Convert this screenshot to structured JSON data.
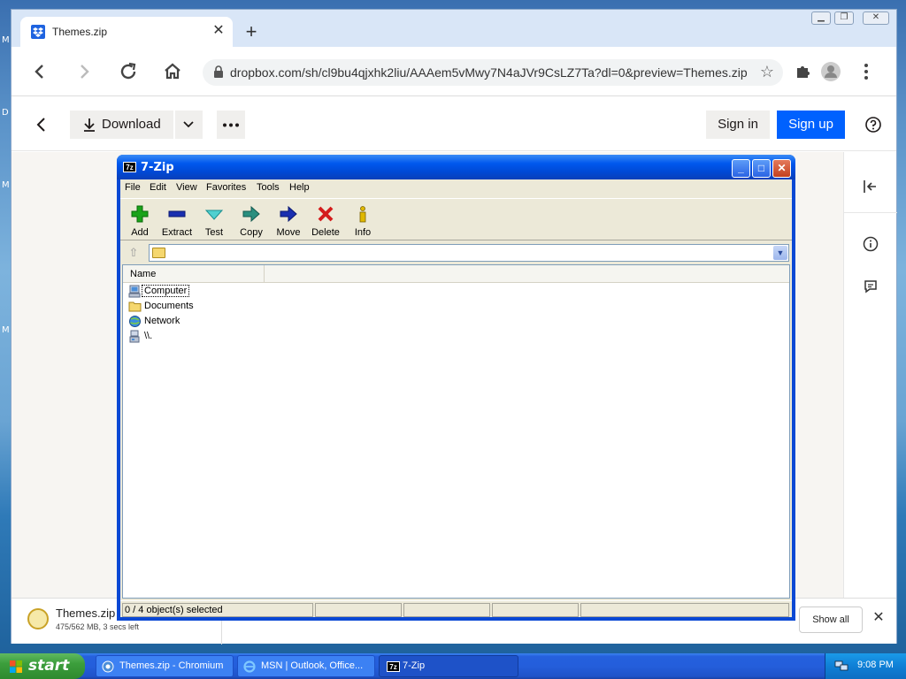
{
  "browser": {
    "tab_title": "Themes.zip",
    "url": "dropbox.com/sh/cl9bu4qjxhk2liu/AAAem5vMwy7N4aJVr9CsLZ7Ta?dl=0&preview=Themes.zip"
  },
  "dropbox": {
    "download_label": "Download",
    "signin_label": "Sign in",
    "signup_label": "Sign up",
    "brand_color": "#0061fe"
  },
  "zip_window": {
    "title": "7-Zip",
    "app_icon_text": "7z",
    "menu": [
      "File",
      "Edit",
      "View",
      "Favorites",
      "Tools",
      "Help"
    ],
    "toolbar": [
      {
        "label": "Add",
        "icon": "plus-icon",
        "color": "#1aa31a"
      },
      {
        "label": "Extract",
        "icon": "minus-icon",
        "color": "#1a2fb0"
      },
      {
        "label": "Test",
        "icon": "check-arrow-icon",
        "color": "#2fb5b5"
      },
      {
        "label": "Copy",
        "icon": "copy-arrow-icon",
        "color": "#2a8f7f"
      },
      {
        "label": "Move",
        "icon": "move-arrow-icon",
        "color": "#1a2fb0"
      },
      {
        "label": "Delete",
        "icon": "delete-x-icon",
        "color": "#d41c1c"
      },
      {
        "label": "Info",
        "icon": "info-icon",
        "color": "#c9a200"
      }
    ],
    "column_name": "Name",
    "items": [
      {
        "name": "Computer",
        "icon": "computer-icon"
      },
      {
        "name": "Documents",
        "icon": "folder-icon"
      },
      {
        "name": "Network",
        "icon": "network-globe-icon"
      },
      {
        "name": "\\\\.",
        "icon": "drive-icon"
      }
    ],
    "status": "0 / 4 object(s) selected"
  },
  "downloads": {
    "file_name": "Themes.zip",
    "file_status": "475/562 MB, 3 secs left",
    "show_all": "Show all"
  },
  "taskbar": {
    "start_label": "start",
    "tasks": [
      {
        "label": "Themes.zip - Chromium"
      },
      {
        "label": "MSN | Outlook, Office..."
      },
      {
        "label": "7-Zip"
      }
    ],
    "clock": "9:08 PM"
  }
}
